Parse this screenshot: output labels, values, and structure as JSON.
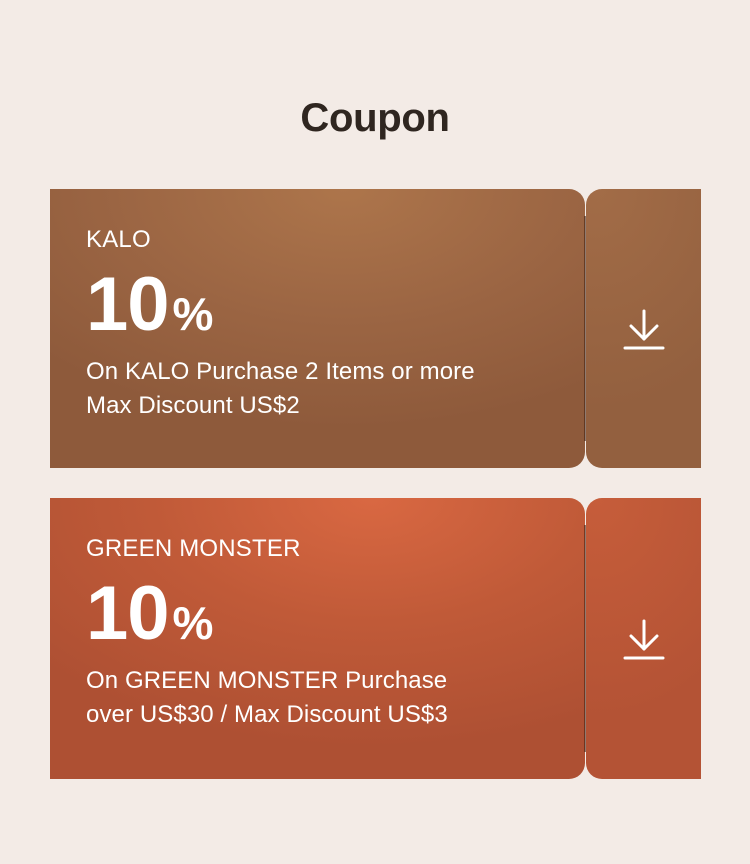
{
  "page": {
    "title": "Coupon"
  },
  "coupons": [
    {
      "brand": "KALO",
      "discount_value": "10",
      "discount_unit": "%",
      "description_line1": "On KALO Purchase 2 Items or more",
      "description_line2": "Max Discount US$2",
      "color": "#9b6543",
      "action_icon": "download-icon"
    },
    {
      "brand": "GREEN MONSTER",
      "discount_value": "10",
      "discount_unit": "%",
      "description_line1": "On GREEN MONSTER Purchase",
      "description_line2": "over US$30 / Max Discount US$3",
      "color": "#c05a38",
      "action_icon": "download-icon"
    }
  ]
}
